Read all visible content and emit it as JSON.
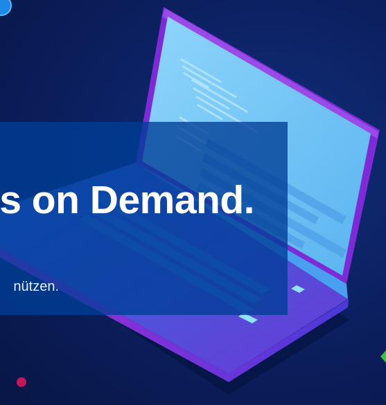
{
  "hero": {
    "title": "s on Demand.",
    "subtitle": "nützen."
  },
  "icons": {
    "laptop": "laptop-illustration-icon",
    "dot": "magenta-dot-icon",
    "badge": "blue-circle-icon",
    "diamond": "green-diamond-icon"
  },
  "colors": {
    "background": "#0c2163",
    "panel": "#003e96",
    "screen": "#6fc6f7",
    "bezel": "#7c2bd6",
    "accent_dot": "#c2185b",
    "accent_green": "#3fbf3f"
  }
}
